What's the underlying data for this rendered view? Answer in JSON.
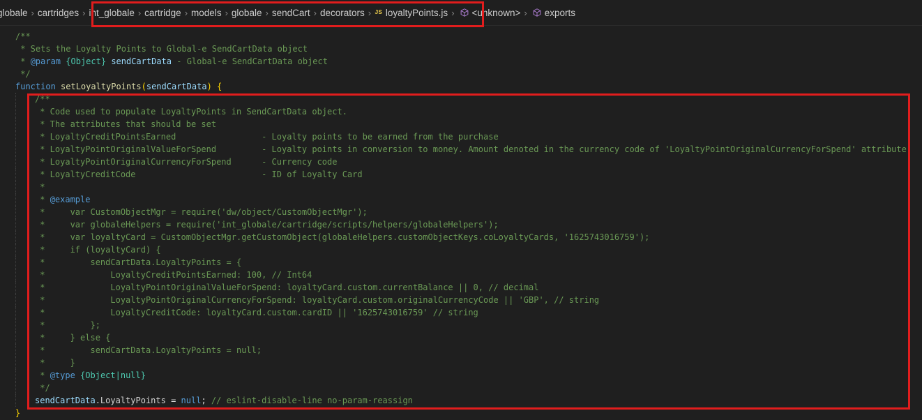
{
  "breadcrumb": {
    "items": [
      "globale",
      "cartridges",
      "int_globale",
      "cartridge",
      "models",
      "globale",
      "sendCart",
      "decorators",
      "loyaltyPoints.js",
      "<unknown>",
      "exports"
    ],
    "file_badge": "JS"
  },
  "code": {
    "header_doc": [
      "/**",
      " * Sets the Loyalty Points to Global-e SendCartData object",
      " * ",
      " */"
    ],
    "param_tag": "@param",
    "param_type": "{Object}",
    "param_name": "sendCartData",
    "param_desc": " - Global-e SendCartData object",
    "fn_keyword": "function",
    "fn_name": "setLoyaltyPoints",
    "fn_params": "sendCartData",
    "inner_doc": [
      "/**",
      " * Code used to populate LoyaltyPoints in SendCartData object.",
      " * The attributes that should be set",
      " * LoyaltyCreditPointsEarned                 - Loyalty points to be earned from the purchase",
      " * LoyaltyPointOriginalValueForSpend         - Loyalty points in conversion to money. Amount denoted in the currency code of 'LoyaltyPointOriginalCurrencyForSpend' attribute",
      " * LoyaltyPointOriginalCurrencyForSpend      - Currency code",
      " * LoyaltyCreditCode                         - ID of Loyalty Card",
      " *",
      " * ",
      " *     var CustomObjectMgr = require('dw/object/CustomObjectMgr');",
      " *     var globaleHelpers = require('int_globale/cartridge/scripts/helpers/globaleHelpers');",
      " *     var loyaltyCard = CustomObjectMgr.getCustomObject(globaleHelpers.customObjectKeys.coLoyaltyCards, '1625743016759');",
      " *     if (loyaltyCard) {",
      " *         sendCartData.LoyaltyPoints = {",
      " *             LoyaltyCreditPointsEarned: 100, // Int64",
      " *             LoyaltyPointOriginalValueForSpend: loyaltyCard.custom.currentBalance || 0, // decimal",
      " *             LoyaltyPointOriginalCurrencyForSpend: loyaltyCard.custom.originalCurrencyCode || 'GBP', // string",
      " *             LoyaltyCreditCode: loyaltyCard.custom.cardID || '1625743016759' // string",
      " *         };",
      " *     } else {",
      " *         sendCartData.LoyaltyPoints = null;",
      " *     }",
      " * ",
      " */"
    ],
    "example_tag": "@example",
    "type_tag": "@type",
    "type_value": "{Object|null}",
    "assign_target": "sendCartData",
    "assign_prop": ".LoyaltyPoints",
    "assign_op": " = ",
    "assign_value": "null",
    "assign_semicolon": ";",
    "assign_comment": " // eslint-disable-line no-param-reassign",
    "open_brace": "{",
    "close_brace": "}"
  },
  "colors": {
    "highlight_box": "#e11d1d",
    "comment": "#6a9955",
    "keyword": "#569cd6",
    "function": "#dcdcaa",
    "variable": "#9cdcfe"
  },
  "icons": {
    "symbol": "cube-icon",
    "separator": "chevron-right-icon"
  }
}
